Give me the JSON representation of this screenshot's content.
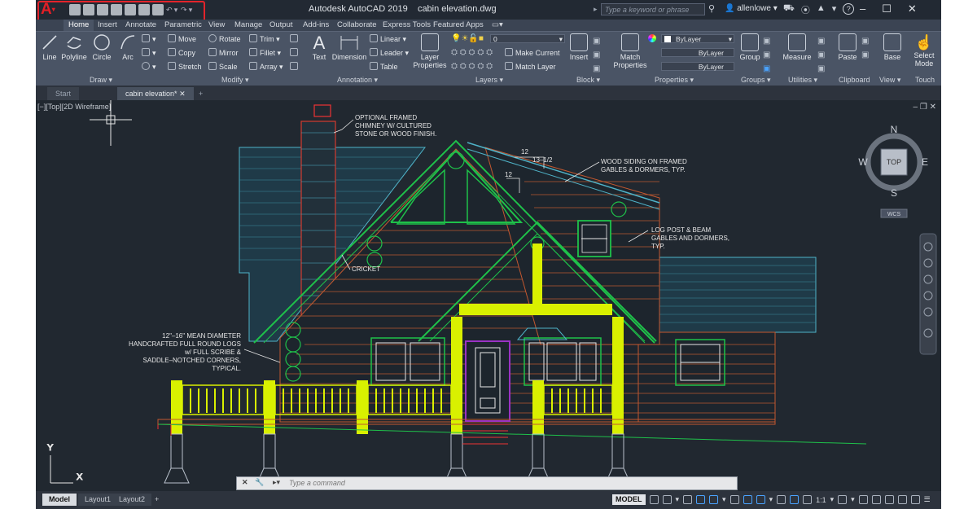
{
  "titlebar": {
    "app_name": "Autodesk AutoCAD 2019",
    "file_name": "cabin elevation.dwg",
    "search_placeholder": "Type a keyword or phrase",
    "username": "allenlowe",
    "help_label": "?"
  },
  "ribbon_tabs": [
    "Home",
    "Insert",
    "Annotate",
    "Parametric",
    "View",
    "Manage",
    "Output",
    "Add-ins",
    "Collaborate",
    "Express Tools",
    "Featured Apps"
  ],
  "ribbon": {
    "draw": {
      "title": "Draw",
      "line": "Line",
      "polyline": "Polyline",
      "circle": "Circle",
      "arc": "Arc"
    },
    "modify": {
      "title": "Modify",
      "move": "Move",
      "rotate": "Rotate",
      "trim": "Trim",
      "copy": "Copy",
      "mirror": "Mirror",
      "fillet": "Fillet",
      "stretch": "Stretch",
      "scale": "Scale",
      "array": "Array"
    },
    "annotation": {
      "title": "Annotation",
      "text": "Text",
      "dimension": "Dimension",
      "linear": "Linear",
      "leader": "Leader",
      "table": "Table"
    },
    "layers": {
      "title": "Layers",
      "layer_properties": "Layer Properties",
      "current_layer": "0",
      "make_current": "Make Current",
      "match_layer": "Match Layer"
    },
    "block": {
      "title": "Block",
      "insert": "Insert"
    },
    "properties": {
      "title": "Properties",
      "match_properties": "Match Properties",
      "bylayer_color": "ByLayer",
      "bylayer_linetype": "ByLayer",
      "bylayer_lineweight": "ByLayer"
    },
    "groups": {
      "title": "Groups",
      "group": "Group"
    },
    "utilities": {
      "title": "Utilities",
      "measure": "Measure"
    },
    "clipboard": {
      "title": "Clipboard",
      "paste": "Paste"
    },
    "view": {
      "title": "View",
      "base": "Base"
    },
    "touch": {
      "title": "Touch",
      "select_mode": "Select Mode"
    }
  },
  "doc_tabs": [
    {
      "label": "Start"
    },
    {
      "label": "cabin elevation*"
    }
  ],
  "viewport": {
    "label": "[−][Top][2D Wireframe]",
    "viewcube": {
      "top": "TOP",
      "n": "N",
      "s": "S",
      "e": "E",
      "w": "W",
      "wcs": "WCS"
    },
    "ucs": {
      "x": "X",
      "y": "Y"
    }
  },
  "drawing_annotations": {
    "chimney": [
      "OPTIONAL FRAMED",
      "CHIMNEY W/ CULTURED",
      "STONE OR WOOD FINISH."
    ],
    "siding": [
      "WOOD SIDING ON FRAMED",
      "GABLES & DORMERS, TYP."
    ],
    "logpost": [
      "LOG POST & BEAM",
      "GABLES AND DORMERS,",
      "TYP."
    ],
    "cricket": "CRICKET",
    "logs": [
      "12\"–16\" MEAN DIAMETER",
      "HANDCRAFTED FULL ROUND LOGS",
      "w/ FULL SCRIBE &",
      "SADDLE–NOTCHED CORNERS,",
      "TYPICAL."
    ],
    "pitch_main_run": "12",
    "pitch_main_rise": "13–1/2",
    "pitch_dormer_run": "12"
  },
  "command_line": {
    "placeholder": "Type a command"
  },
  "layout_tabs": [
    "Model",
    "Layout1",
    "Layout2"
  ],
  "statusbar": {
    "model": "MODEL",
    "scale": "1:1"
  },
  "colors": {
    "accent_red": "#e3242b",
    "highlight_yellow": "#d9f000",
    "canvas": "#212830",
    "ribbon": "#4a5465"
  }
}
